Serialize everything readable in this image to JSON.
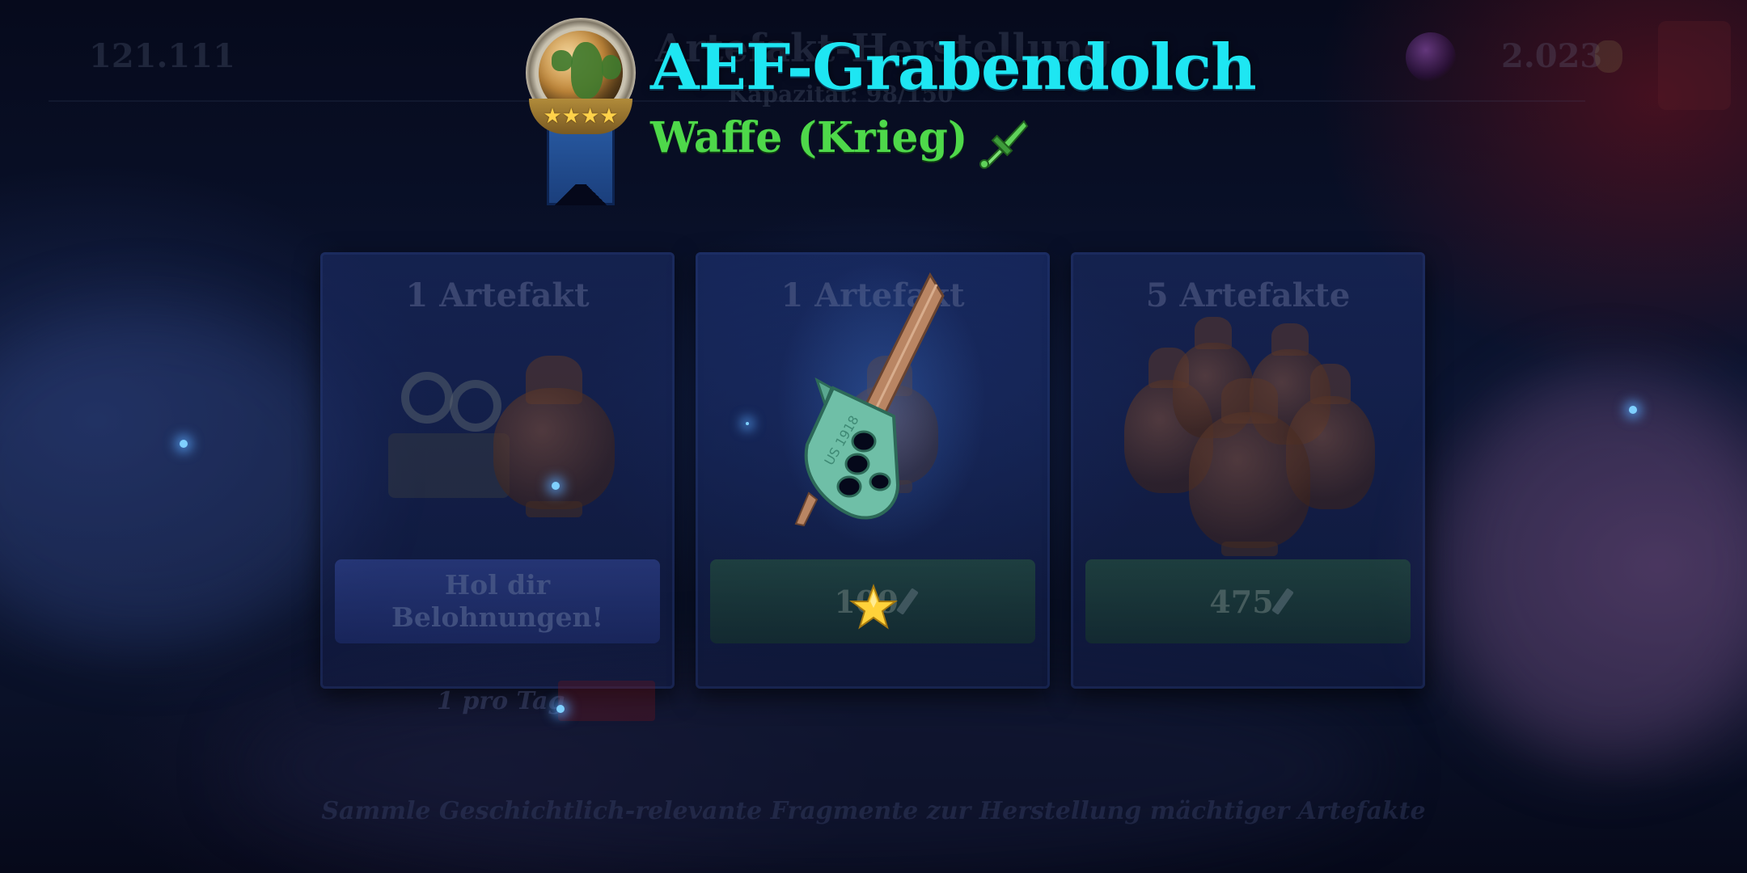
{
  "background_hud": {
    "currency_left": "121.111",
    "panel_title": "Artefakt-Herstellung",
    "capacity": "Kapazität: 98/150",
    "currency_right": "2.023"
  },
  "cards": [
    {
      "title": "1 Artefakt",
      "button_label": "Hol dir Belohnungen!",
      "note": "1 pro Tag"
    },
    {
      "title": "1 Artefakt",
      "cost": "100"
    },
    {
      "title": "5 Artefakte",
      "cost": "475"
    }
  ],
  "footer_hint": "Sammle Geschichtlich-relevante Fragmente zur Herstellung mächtiger Artefakte",
  "popup": {
    "artifact_name": "AEF-Grabendolch",
    "artifact_type": "Waffe (Krieg)",
    "medal_stars": "★★★★",
    "type_icon": "sword-icon",
    "dagger_engraving": "US 1918"
  },
  "colors": {
    "title": "#1ee6f2",
    "subtitle": "#4ed84a",
    "background": "#05081a"
  }
}
